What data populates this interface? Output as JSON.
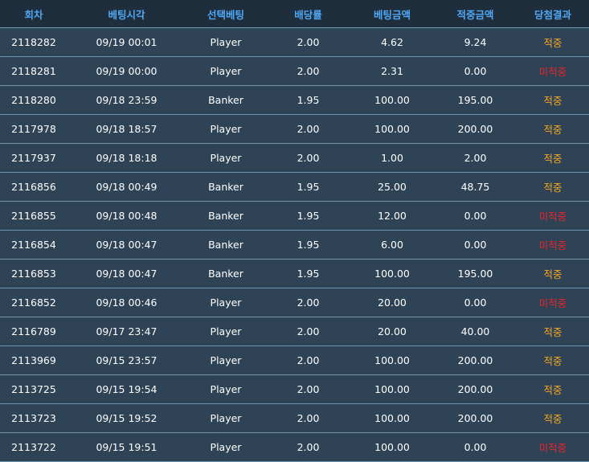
{
  "columns": [
    "회차",
    "베팅시각",
    "선택베팅",
    "배당률",
    "베팅금액",
    "적중금액",
    "당첨결과"
  ],
  "colors": {
    "hit": "#f5a623",
    "miss": "#e8242c",
    "header_text": "#4fa6f2"
  },
  "rows": [
    {
      "round": "2118282",
      "time": "09/19 00:01",
      "pick": "Player",
      "odds": "2.00",
      "bet": "4.62",
      "win": "9.24",
      "result": "적중",
      "status": "hit"
    },
    {
      "round": "2118281",
      "time": "09/19 00:00",
      "pick": "Player",
      "odds": "2.00",
      "bet": "2.31",
      "win": "0.00",
      "result": "미적중",
      "status": "miss"
    },
    {
      "round": "2118280",
      "time": "09/18 23:59",
      "pick": "Banker",
      "odds": "1.95",
      "bet": "100.00",
      "win": "195.00",
      "result": "적중",
      "status": "hit"
    },
    {
      "round": "2117978",
      "time": "09/18 18:57",
      "pick": "Player",
      "odds": "2.00",
      "bet": "100.00",
      "win": "200.00",
      "result": "적중",
      "status": "hit"
    },
    {
      "round": "2117937",
      "time": "09/18 18:18",
      "pick": "Player",
      "odds": "2.00",
      "bet": "1.00",
      "win": "2.00",
      "result": "적중",
      "status": "hit"
    },
    {
      "round": "2116856",
      "time": "09/18 00:49",
      "pick": "Banker",
      "odds": "1.95",
      "bet": "25.00",
      "win": "48.75",
      "result": "적중",
      "status": "hit"
    },
    {
      "round": "2116855",
      "time": "09/18 00:48",
      "pick": "Banker",
      "odds": "1.95",
      "bet": "12.00",
      "win": "0.00",
      "result": "미적중",
      "status": "miss"
    },
    {
      "round": "2116854",
      "time": "09/18 00:47",
      "pick": "Banker",
      "odds": "1.95",
      "bet": "6.00",
      "win": "0.00",
      "result": "미적중",
      "status": "miss"
    },
    {
      "round": "2116853",
      "time": "09/18 00:47",
      "pick": "Banker",
      "odds": "1.95",
      "bet": "100.00",
      "win": "195.00",
      "result": "적중",
      "status": "hit"
    },
    {
      "round": "2116852",
      "time": "09/18 00:46",
      "pick": "Player",
      "odds": "2.00",
      "bet": "20.00",
      "win": "0.00",
      "result": "미적중",
      "status": "miss"
    },
    {
      "round": "2116789",
      "time": "09/17 23:47",
      "pick": "Player",
      "odds": "2.00",
      "bet": "20.00",
      "win": "40.00",
      "result": "적중",
      "status": "hit"
    },
    {
      "round": "2113969",
      "time": "09/15 23:57",
      "pick": "Player",
      "odds": "2.00",
      "bet": "100.00",
      "win": "200.00",
      "result": "적중",
      "status": "hit"
    },
    {
      "round": "2113725",
      "time": "09/15 19:54",
      "pick": "Player",
      "odds": "2.00",
      "bet": "100.00",
      "win": "200.00",
      "result": "적중",
      "status": "hit"
    },
    {
      "round": "2113723",
      "time": "09/15 19:52",
      "pick": "Player",
      "odds": "2.00",
      "bet": "100.00",
      "win": "200.00",
      "result": "적중",
      "status": "hit"
    },
    {
      "round": "2113722",
      "time": "09/15 19:51",
      "pick": "Player",
      "odds": "2.00",
      "bet": "100.00",
      "win": "0.00",
      "result": "미적중",
      "status": "miss"
    }
  ]
}
